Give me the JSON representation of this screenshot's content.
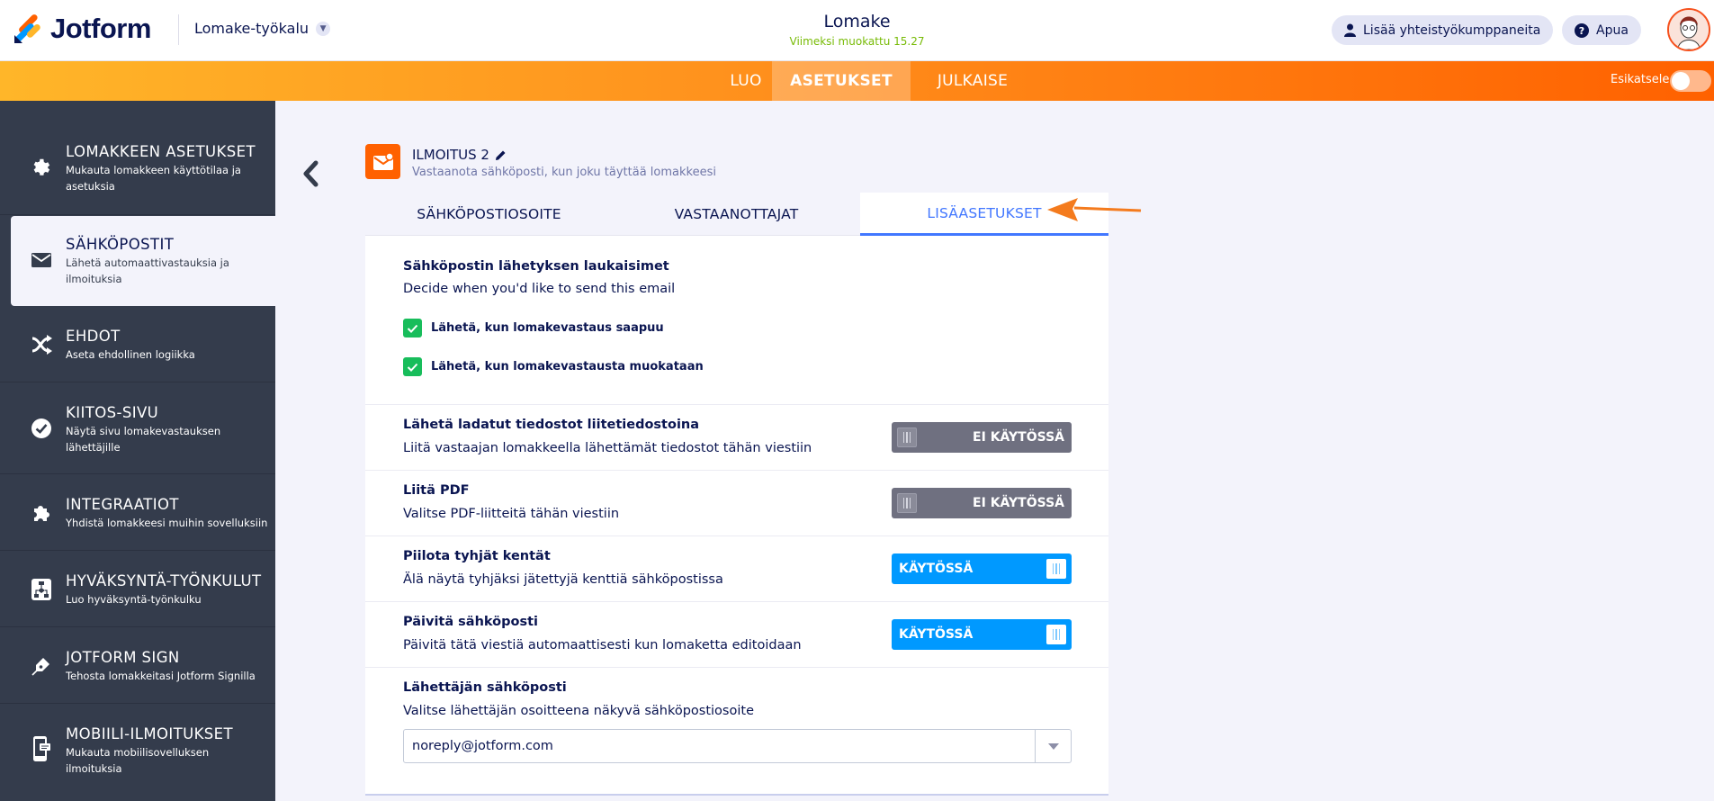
{
  "header": {
    "logo_text": "Jotform",
    "builder_menu": "Lomake-työkalu",
    "form_title": "Lomake",
    "last_edited": "Viimeksi muokattu 15.27",
    "add_collaborators": "Lisää yhteistyökumppaneita",
    "help": "Apua"
  },
  "nav": {
    "tabs": [
      "LUO",
      "ASETUKSET",
      "JULKAISE"
    ],
    "active_tab": "ASETUKSET",
    "preview_label": "Esikatsele",
    "preview_on": false
  },
  "sidebar": {
    "items": [
      {
        "title": "LOMAKKEEN ASETUKSET",
        "desc": "Mukauta lomakkeen käyttötilaa ja asetuksia",
        "icon": "gear-icon"
      },
      {
        "title": "SÄHKÖPOSTIT",
        "desc": "Lähetä automaattivastauksia ja ilmoituksia",
        "icon": "envelope-icon",
        "active": true
      },
      {
        "title": "EHDOT",
        "desc": "Aseta ehdollinen logiikka",
        "icon": "shuffle-icon"
      },
      {
        "title": "KIITOS-SIVU",
        "desc": "Näytä sivu lomakevastauksen lähettäjille",
        "icon": "check-circle-icon"
      },
      {
        "title": "INTEGRAATIOT",
        "desc": "Yhdistä lomakkeesi muihin sovelluksiin",
        "icon": "puzzle-icon"
      },
      {
        "title": "HYVÄKSYNTÄ-TYÖNKULUT",
        "desc": "Luo hyväksyntä-työnkulku",
        "icon": "workflow-icon"
      },
      {
        "title": "JOTFORM SIGN",
        "desc": "Tehosta lomakkeitasi Jotform Signilla",
        "icon": "pen-nib-icon"
      },
      {
        "title": "MOBIILI-ILMOITUKSET",
        "desc": "Mukauta mobiilisovelluksen ilmoituksia",
        "icon": "mobile-icon"
      }
    ]
  },
  "notification": {
    "title": "ILMOITUS 2",
    "subtitle": "Vastaanota sähköposti, kun joku täyttää lomakkeesi"
  },
  "tabs": {
    "items": [
      "SÄHKÖPOSTIOSOITE",
      "VASTAANOTTAJAT",
      "LISÄASETUKSET"
    ],
    "active": "LISÄASETUKSET"
  },
  "triggers": {
    "title": "Sähköpostin lähetyksen laukaisimet",
    "desc": "Decide when you'd like to send this email",
    "options": [
      {
        "label": "Lähetä, kun lomakevastaus saapuu",
        "checked": true
      },
      {
        "label": "Lähetä, kun lomakevastausta muokataan",
        "checked": true
      }
    ]
  },
  "settings": [
    {
      "title": "Lähetä ladatut tiedostot liitetiedostoina",
      "desc": "Liitä vastaajan lomakkeella lähettämät tiedostot tähän viestiin",
      "state": "EI KÄYTÖSSÄ",
      "on": false
    },
    {
      "title": "Liitä PDF",
      "desc": "Valitse PDF-liitteitä tähän viestiin",
      "state": "EI KÄYTÖSSÄ",
      "on": false
    },
    {
      "title": "Piilota tyhjät kentät",
      "desc": "Älä näytä tyhjäksi jätettyjä kenttiä sähköpostissa",
      "state": "KÄYTÖSSÄ",
      "on": true
    },
    {
      "title": "Päivitä sähköposti",
      "desc": "Päivitä tätä viestiä automaattisesti kun lomaketta editoidaan",
      "state": "KÄYTÖSSÄ",
      "on": true
    }
  ],
  "sender": {
    "title": "Lähettäjän sähköposti",
    "desc": "Valitse lähettäjän osoitteena näkyvä sähköpostiosoite",
    "value": "noreply@jotform.com"
  },
  "colors": {
    "brand_orange": "#ff6100",
    "sidebar_bg": "#343c4c",
    "toggle_on": "#0099ff",
    "toggle_off": "#6f7080",
    "checkbox": "#18bd5b",
    "active_tab": "#4277ff"
  }
}
